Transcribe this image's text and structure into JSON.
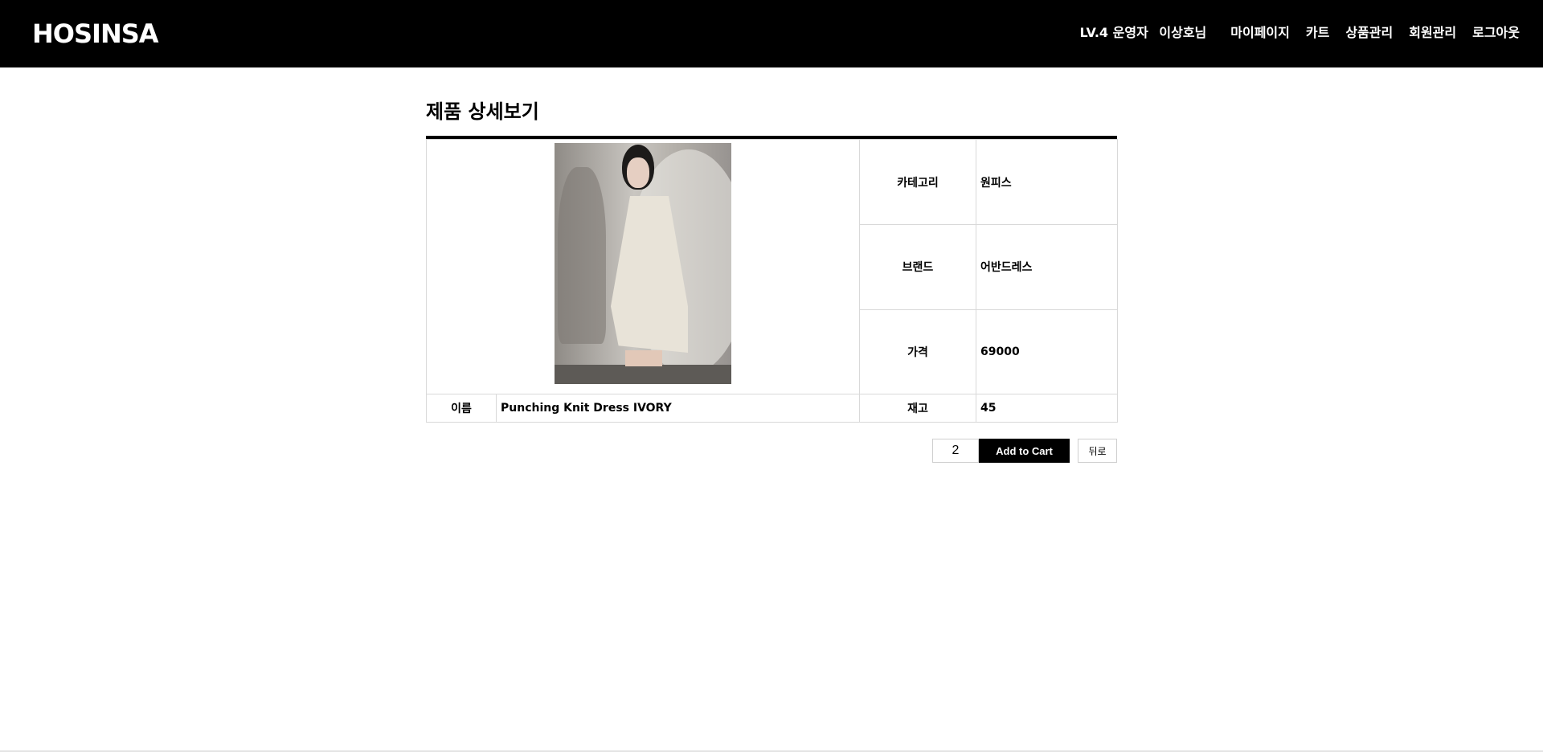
{
  "header": {
    "logo": "HOSINSA",
    "user_level": "LV.4 운영자",
    "user_name": "이상호님",
    "nav": [
      "마이페이지",
      "카트",
      "상품관리",
      "회원관리",
      "로그아웃"
    ]
  },
  "page": {
    "title": "제품 상세보기"
  },
  "product": {
    "category_label": "카테고리",
    "category_value": "원피스",
    "brand_label": "브랜드",
    "brand_value": "어반드레스",
    "price_label": "가격",
    "price_value": "69000",
    "name_label": "이름",
    "name_value": "Punching Knit Dress IVORY",
    "stock_label": "재고",
    "stock_value": "45"
  },
  "actions": {
    "quantity": "2",
    "add_to_cart": "Add to Cart",
    "back": "뒤로"
  },
  "colors": {
    "header_bg": "#000000",
    "accent": "#000000"
  }
}
